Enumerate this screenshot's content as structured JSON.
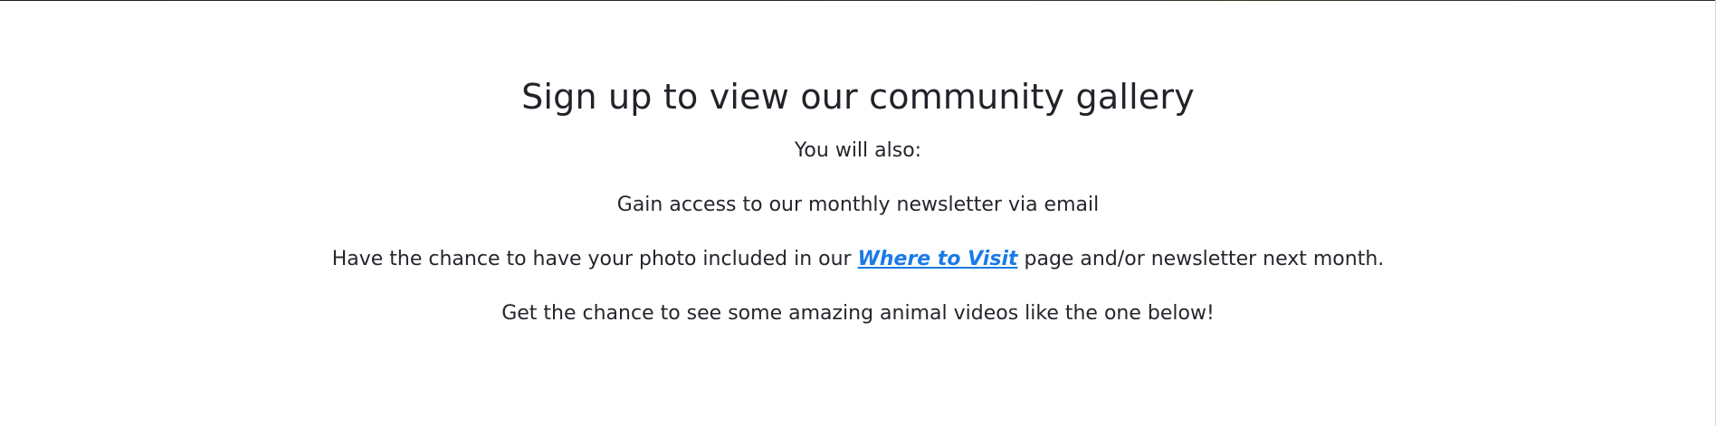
{
  "signup": {
    "heading": "Sign up to view our community gallery",
    "intro": "You will also:",
    "benefit_newsletter": "Gain access to our monthly newsletter via email",
    "benefit_photo_before": "Have the chance to have your photo included in our ",
    "benefit_photo_link": "Where to Visit",
    "benefit_photo_after": " page and/or newsletter next month.",
    "benefit_videos": "Get the chance to see some amazing animal videos like the one below!"
  },
  "colors": {
    "text": "#22232a",
    "link": "#1a7ae8",
    "background": "#ffffff"
  }
}
